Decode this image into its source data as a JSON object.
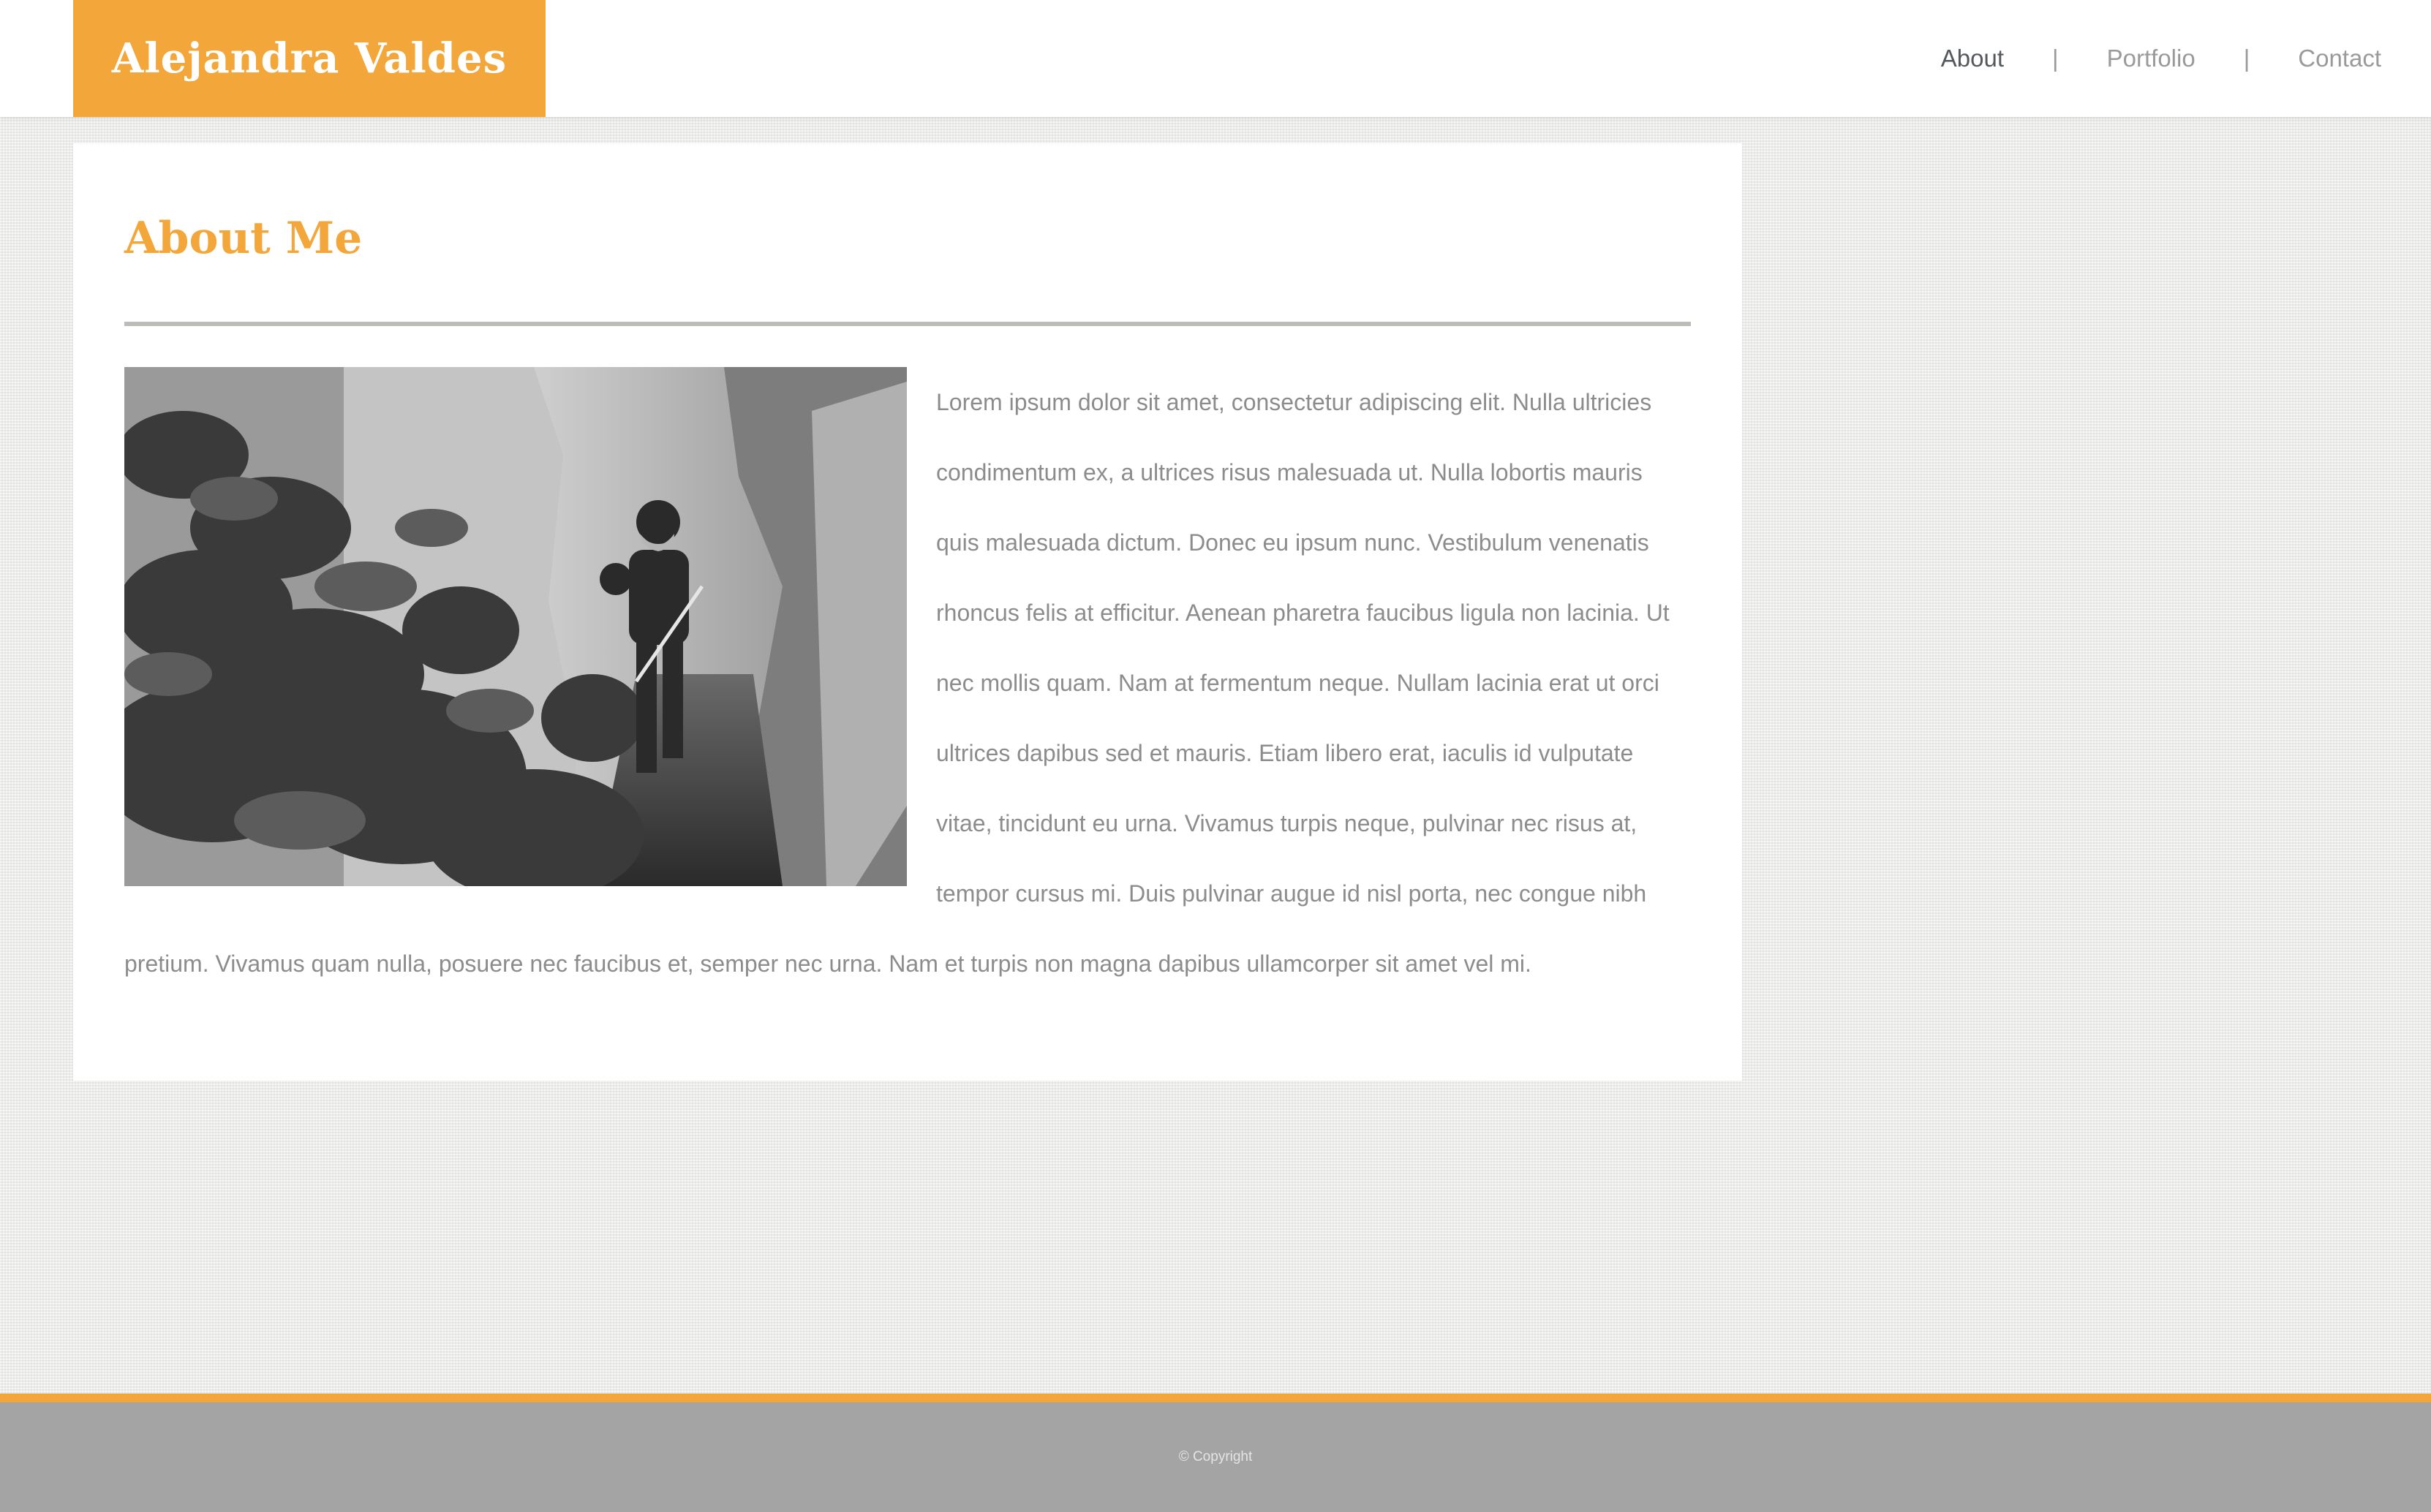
{
  "header": {
    "site_name": "Alejandra Valdes",
    "nav": [
      {
        "label": "About",
        "active": true
      },
      {
        "separator": "|"
      },
      {
        "label": "Portfolio",
        "active": false
      },
      {
        "separator": "|"
      },
      {
        "label": "Contact",
        "active": false
      }
    ]
  },
  "main": {
    "title": "About Me",
    "body": "Lorem ipsum dolor sit amet, consectetur adipiscing elit. Nulla ultricies condimentum ex, a ultrices risus malesuada ut. Nulla lobortis mauris quis malesuada dictum. Donec eu ipsum nunc. Vestibulum venenatis rhoncus felis at efficitur. Aenean pharetra faucibus ligula non lacinia. Ut nec mollis quam. Nam at fermentum neque. Nullam lacinia erat ut orci ultrices dapibus sed et mauris. Etiam libero erat, iaculis id vulputate vitae, tincidunt eu urna. Vivamus turpis neque, pulvinar nec risus at, tempor cursus mi. Duis pulvinar augue id nisl porta, nec congue nibh pretium. Vivamus quam nulla, posuere nec faucibus et, semper nec urna. Nam et turpis non magna dapibus ullamcorper sit amet vel mi."
  },
  "footer": {
    "copyright": "© Copyright"
  },
  "colors": {
    "accent": "#f3a73b",
    "footer_bg": "#a4a4a4",
    "body_text": "#8c8c8c",
    "nav_active": "#55585c",
    "nav_inactive": "#9a9a9a"
  }
}
